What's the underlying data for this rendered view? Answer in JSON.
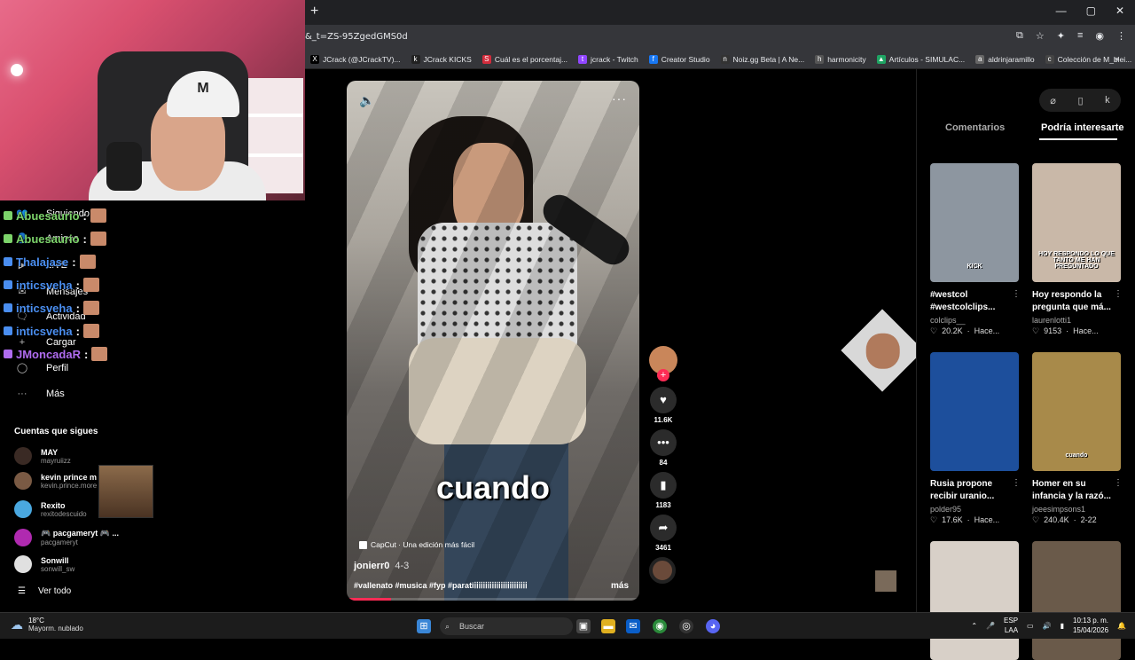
{
  "browser": {
    "newtab_label": "+",
    "url": "&_t=ZS-95ZgedGMS0d",
    "window_buttons": [
      "—",
      "▢",
      "✕"
    ],
    "bookmarks": [
      {
        "label": "JCrack (@JCrackTV)...",
        "icon": "x-icon",
        "color": "#000000",
        "glyph": "X"
      },
      {
        "label": "JCrack KICKS",
        "icon": "kick-icon",
        "color": "#222222",
        "glyph": "k"
      },
      {
        "label": "Cuál es el porcentaj...",
        "icon": "s-icon",
        "color": "#d22c3c",
        "glyph": "S"
      },
      {
        "label": "jcrack - Twitch",
        "icon": "twitch-icon",
        "color": "#9146ff",
        "glyph": "t"
      },
      {
        "label": "Creator Studio",
        "icon": "facebook-icon",
        "color": "#1877f2",
        "glyph": "f"
      },
      {
        "label": "Noiz.gg Beta | A Ne...",
        "icon": "noiz-icon",
        "color": "#333333",
        "glyph": "n"
      },
      {
        "label": "harmonicity",
        "icon": "harmonicity-icon",
        "color": "#555555",
        "glyph": "h"
      },
      {
        "label": "Artículos - SIMULAC...",
        "icon": "drive-icon",
        "color": "#1fa463",
        "glyph": "▲"
      },
      {
        "label": "aldrinjaramillo",
        "icon": "user-icon",
        "color": "#666666",
        "glyph": "a"
      },
      {
        "label": "Colección de M_blei...",
        "icon": "collection-icon",
        "color": "#444444",
        "glyph": "c"
      }
    ],
    "bookmarks_more": "»"
  },
  "overlay": {
    "nav": [
      {
        "label": "Siguiendo",
        "icon": "following-icon",
        "glyph": "👥"
      },
      {
        "label": "Amigos",
        "icon": "friends-icon",
        "glyph": "👤"
      },
      {
        "label": "LIVE",
        "icon": "live-icon",
        "glyph": "▶"
      },
      {
        "label": "Mensajes",
        "icon": "messages-icon",
        "glyph": "✉"
      },
      {
        "label": "Actividad",
        "icon": "activity-icon",
        "glyph": "🗨"
      },
      {
        "label": "Cargar",
        "icon": "upload-icon",
        "glyph": "+"
      },
      {
        "label": "Perfil",
        "icon": "profile-icon",
        "glyph": "◯"
      },
      {
        "label": "Más",
        "icon": "more-icon",
        "glyph": "···"
      }
    ],
    "chat": [
      {
        "user": "Abuesaurio",
        "sep": ":",
        "color": "#7cd36a"
      },
      {
        "user": "Abuesaurio",
        "sep": ":",
        "color": "#7cd36a"
      },
      {
        "user": "Thalajase",
        "sep": ":",
        "color": "#4a8ef0"
      },
      {
        "user": "inticsveha",
        "sep": ":",
        "color": "#4a8ef0"
      },
      {
        "user": "inticsveha",
        "sep": ":",
        "color": "#4a8ef0"
      },
      {
        "user": "inticsveha",
        "sep": ":",
        "color": "#4a8ef0"
      },
      {
        "user": "JMoncadaR",
        "sep": ":",
        "color": "#b06cf0"
      }
    ],
    "following_title": "Cuentas que sigues",
    "accounts": [
      {
        "name": "MAY",
        "handle": "mayruiizz",
        "color": "#3a2a24"
      },
      {
        "name": "kevin prince m",
        "handle": "kevin.prince.more",
        "color": "#7a5a44"
      },
      {
        "name": "Rexito",
        "handle": "rexitodescuido",
        "color": "#4aa8e0"
      },
      {
        "name": "🎮 pacgameryt 🎮 ...",
        "handle": "pacgameryt",
        "color": "#b02ab0"
      },
      {
        "name": "Sonwill",
        "handle": "sonwill_sw",
        "color": "#e0e0e0"
      }
    ],
    "see_all": "Ver todo"
  },
  "video": {
    "caption_word": "cuando",
    "capcut_label": "CapCut · Una edición más fácil",
    "author": "jonierr0",
    "date": "4-3",
    "description": "#vallenato #musica #fyp #parati𝗂𝗂𝗂𝗂𝗂𝗂𝗂𝗂𝗂𝗂𝗂𝗂𝗂𝗂𝗂𝗂𝗂𝗂𝗂𝗂𝗂𝗂𝗂𝗂",
    "more_label": "más",
    "progress": 0.15,
    "mute_icon": "🔈",
    "more_icon": "···"
  },
  "actions": {
    "follow_plus": "+",
    "items": [
      {
        "name": "like-button",
        "icon": "heart-icon",
        "glyph": "♥",
        "count": "11.6K"
      },
      {
        "name": "comment-button",
        "icon": "comment-icon",
        "glyph": "•••",
        "count": "84"
      },
      {
        "name": "save-button",
        "icon": "bookmark-icon",
        "glyph": "▮",
        "count": "1183"
      },
      {
        "name": "share-button",
        "icon": "share-icon",
        "glyph": "➦",
        "count": "3461"
      }
    ]
  },
  "right_panel": {
    "tabs": [
      "Comentarios",
      "Podría interesarte"
    ],
    "active_tab": 1,
    "icons": [
      "⌀",
      "▯",
      "k"
    ],
    "cards": [
      {
        "title": "#westcol #westcolclips...",
        "user": "colclips__",
        "likes": "20.2K",
        "time": "Hace...",
        "thumb_text": "KICK",
        "bg": "#8d96a0"
      },
      {
        "title": "Hoy respondo la pregunta que má...",
        "user": "laurenlotti1",
        "likes": "9153",
        "time": "Hace...",
        "thumb_text": "HOY RESPONDO LO QUE TANTO ME HAN PREGUNTADO",
        "bg": "#c9b8a8"
      },
      {
        "title": "Rusia propone recibir uranio...",
        "user": "polder95",
        "likes": "17.6K",
        "time": "Hace...",
        "thumb_text": "",
        "bg": "#1d4f9c"
      },
      {
        "title": "Homer en su infancia y la razó...",
        "user": "joeesimpsons1",
        "likes": "240.4K",
        "time": "2-22",
        "thumb_text": "cuando",
        "bg": "#a88a4a"
      },
      {
        "title": "",
        "user": "",
        "likes": "",
        "time": "",
        "thumb_text": "",
        "bg": "#d8d0c8"
      },
      {
        "title": "",
        "user": "",
        "likes": "",
        "time": "",
        "thumb_text": "",
        "bg": "#6a5a4a"
      }
    ]
  },
  "taskbar": {
    "temp": "18°C",
    "weather": "Mayorm. nublado",
    "search_placeholder": "Buscar",
    "lang_top": "ESP",
    "lang_bottom": "LAA",
    "time": "10:13 p. m.",
    "date": "15/04/2026"
  }
}
